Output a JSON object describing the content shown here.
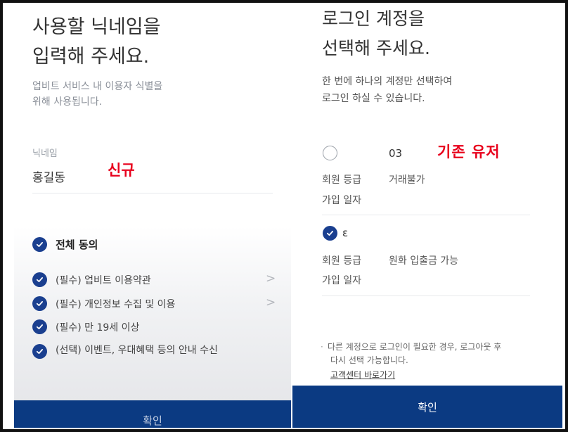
{
  "left": {
    "title_line1": "사용할 닉네임을",
    "title_line2": "입력해 주세요.",
    "subtitle_line1": "업비트 서비스 내 이용자 식별을",
    "subtitle_line2": "위해 사용됩니다.",
    "nickname_label": "닉네임",
    "nickname_value": "홍길동",
    "annotation": "신규",
    "agree_all": "전체 동의",
    "agreements": [
      {
        "label": "(필수) 업비트 이용약관",
        "has_chevron": true
      },
      {
        "label": "(필수) 개인정보 수집 및 이용",
        "has_chevron": true
      },
      {
        "label": "(필수) 만 19세 이상",
        "has_chevron": false
      },
      {
        "label": "(선택) 이벤트, 우대혜택 등의 안내 수신",
        "has_chevron": false
      }
    ],
    "chevron": ">",
    "confirm_label": "확인"
  },
  "right": {
    "title_line1": "로그인 계정을",
    "title_line2": "선택해 주세요.",
    "subtitle_line1": "한 번에 하나의 계정만 선택하여",
    "subtitle_line2": "로그인 하실 수 있습니다.",
    "annotation": "기존 유저",
    "accounts": [
      {
        "id": "03",
        "selected": false,
        "grade_label": "회원 등급",
        "grade_value": "거래불가",
        "join_label": "가입 일자",
        "join_value": ""
      },
      {
        "id": "ε",
        "selected": true,
        "grade_label": "회원 등급",
        "grade_value": "원화 입출금 가능",
        "join_label": "가입 일자",
        "join_value": ""
      }
    ],
    "note_line1": "다른 계정으로 로그인이 필요한 경우, 로그아웃 후",
    "note_line2": "다시 선택 가능합니다.",
    "note_bullet": "·",
    "cs_link": "고객센터 바로가기",
    "confirm_label": "확인"
  },
  "colors": {
    "brand_navy": "#0b3a82",
    "check_blue": "#1a3f8f",
    "annotation_red": "#e8001c"
  },
  "icons": {
    "check": "check-circle-icon",
    "radio_empty": "radio-unchecked-icon",
    "chevron": "chevron-right-icon"
  }
}
